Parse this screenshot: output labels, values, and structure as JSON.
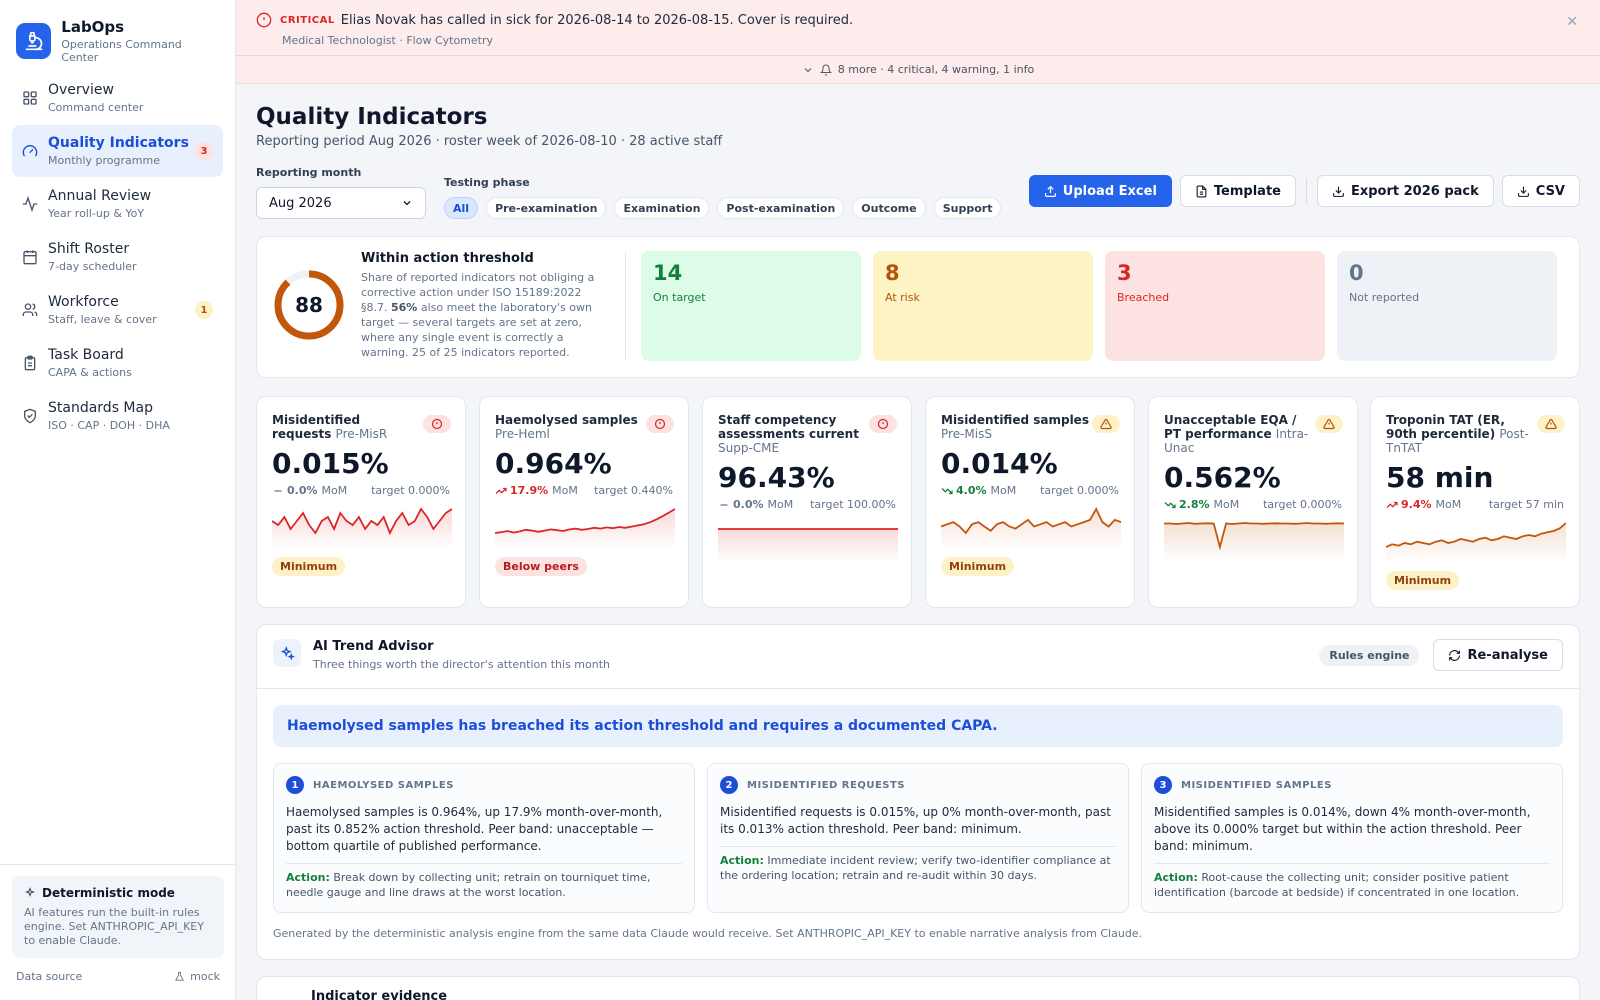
{
  "brand": {
    "name": "LabOps",
    "subtitle": "Operations Command Center"
  },
  "nav": [
    {
      "label": "Overview",
      "sub": "Command center",
      "icon": "grid-icon",
      "badge": ""
    },
    {
      "label": "Quality Indicators",
      "sub": "Monthly programme",
      "icon": "gauge-icon",
      "badge": "3",
      "active": true
    },
    {
      "label": "Annual Review",
      "sub": "Year roll-up & YoY",
      "icon": "activity-icon",
      "badge": ""
    },
    {
      "label": "Shift Roster",
      "sub": "7-day scheduler",
      "icon": "calendar-icon",
      "badge": ""
    },
    {
      "label": "Workforce",
      "sub": "Staff, leave & cover",
      "icon": "users-icon",
      "badge": "1"
    },
    {
      "label": "Task Board",
      "sub": "CAPA & actions",
      "icon": "clipboard-icon",
      "badge": ""
    },
    {
      "label": "Standards Map",
      "sub": "ISO · CAP · DOH · DHA",
      "icon": "shield-icon",
      "badge": ""
    }
  ],
  "deterministic": {
    "title": "Deterministic mode",
    "text": "AI features run the built-in rules engine. Set ANTHROPIC_API_KEY to enable Claude."
  },
  "data_source": {
    "label": "Data source",
    "value": "mock"
  },
  "alert": {
    "level": "CRITICAL",
    "message": "Elias Novak has called in sick for 2026-08-14 to 2026-08-15. Cover is required.",
    "sub": "Medical Technologist · Flow Cytometry",
    "more": "8 more · 4 critical, 4 warning, 1 info"
  },
  "page": {
    "title": "Quality Indicators",
    "subtitle": "Reporting period Aug 2026 · roster week of 2026-08-10 · 28 active staff"
  },
  "controls": {
    "month_label": "Reporting month",
    "month_value": "Aug 2026",
    "phase_label": "Testing phase",
    "phases": [
      "All",
      "Pre-examination",
      "Examination",
      "Post-examination",
      "Outcome",
      "Support"
    ],
    "active_phase": "All",
    "upload": "Upload Excel",
    "template": "Template",
    "export": "Export 2026 pack",
    "csv": "CSV"
  },
  "summary": {
    "score": "88",
    "score_fraction": 0.88,
    "title": "Within action threshold",
    "desc_1": "Share of reported indicators not obliging a corrective action under ISO 15189:2022 §8.7.",
    "desc_pct": "56%",
    "desc_2": "also meet the laboratory's own target — several targets are set at zero, where any single event is correctly a warning. 25 of 25 indicators reported.",
    "stats": [
      {
        "value": "14",
        "label": "On target",
        "tone": "green"
      },
      {
        "value": "8",
        "label": "At risk",
        "tone": "yellow"
      },
      {
        "value": "3",
        "label": "Breached",
        "tone": "red"
      },
      {
        "value": "0",
        "label": "Not reported",
        "tone": "grey"
      }
    ]
  },
  "cards": [
    {
      "title": "Misidentified requests",
      "code": "Pre-MisR",
      "value": "0.015%",
      "delta": "0.0%",
      "trend": "flat",
      "mom": "MoM",
      "target": "target 0.000%",
      "flag": "red",
      "tag": "Minimum",
      "tag_tone": "amber",
      "spark": [
        5,
        4,
        6,
        3,
        5,
        7,
        4,
        2,
        5,
        6,
        3,
        7,
        5,
        4,
        6,
        3,
        5,
        4,
        6,
        2,
        5,
        7,
        4,
        5,
        8,
        6,
        3,
        5,
        7,
        8
      ]
    },
    {
      "title": "Haemolysed samples",
      "code": "Pre-Heml",
      "value": "0.964%",
      "delta": "17.9%",
      "trend": "up",
      "mom": "MoM",
      "target": "target 0.440%",
      "flag": "red",
      "tag": "Below peers",
      "tag_tone": "red",
      "spark": [
        2,
        2.2,
        2.5,
        2.1,
        2.4,
        2.8,
        2.6,
        2.3,
        2.6,
        2.9,
        2.7,
        2.5,
        2.9,
        3.1,
        2.8,
        3,
        3.3,
        3.1,
        3.4,
        3.2,
        3.5,
        3.3,
        3.6,
        3.9,
        4.2,
        4.7,
        5.4,
        6.2,
        7.1,
        8
      ]
    },
    {
      "title": "Staff competency assessments current",
      "code": "Supp-CME",
      "value": "96.43%",
      "delta": "0.0%",
      "trend": "flat",
      "mom": "MoM",
      "target": "target 100.00%",
      "flag": "red",
      "tag": "",
      "tag_tone": "",
      "spark": [
        5,
        5,
        5,
        5,
        5,
        5,
        5,
        5,
        5,
        5,
        5,
        5,
        5,
        5,
        5,
        5,
        5,
        5,
        5,
        5,
        5,
        5,
        5,
        5,
        5,
        5,
        5,
        5,
        5,
        5
      ]
    },
    {
      "title": "Misidentified samples",
      "code": "Pre-MisS",
      "value": "0.014%",
      "delta": "4.0%",
      "trend": "down",
      "mom": "MoM",
      "target": "target 0.000%",
      "flag": "amber",
      "tag": "Minimum",
      "tag_tone": "amber",
      "spark": [
        5,
        5.5,
        6,
        5,
        3.5,
        5.5,
        6,
        5,
        4,
        5.5,
        6,
        5,
        4.5,
        5.5,
        6.5,
        5,
        5.5,
        6,
        5,
        5.5,
        6,
        5,
        5.5,
        6,
        6.5,
        9,
        6,
        5,
        6.5,
        6
      ]
    },
    {
      "title": "Unacceptable EQA / PT performance",
      "code": "Intra-Unac",
      "value": "0.562%",
      "delta": "2.8%",
      "trend": "down",
      "mom": "MoM",
      "target": "target 0.000%",
      "flag": "amber",
      "tag": "",
      "tag_tone": "",
      "spark": [
        6,
        6,
        5.8,
        6,
        6.2,
        5.9,
        6,
        6.1,
        6,
        -3,
        6,
        5.8,
        6,
        6.2,
        6,
        6,
        5.9,
        6,
        6.1,
        6,
        6,
        5.9,
        6,
        6.2,
        6,
        6,
        5.9,
        6,
        6.1,
        6
      ]
    },
    {
      "title": "Troponin TAT (ER, 90th percentile)",
      "code": "Post-TnTAT",
      "value": "58 min",
      "delta": "9.4%",
      "trend": "up",
      "mom": "MoM",
      "target": "target 57 min",
      "flag": "amber",
      "tag": "Minimum",
      "tag_tone": "amber",
      "spark": [
        5,
        5.2,
        5.1,
        5.3,
        5.2,
        5.4,
        5.3,
        5.2,
        5.4,
        5.5,
        5.3,
        5.4,
        5.6,
        5.5,
        5.4,
        5.6,
        5.7,
        5.5,
        5.6,
        5.8,
        5.7,
        5.6,
        5.8,
        5.9,
        5.8,
        6,
        6.1,
        6.2,
        6.4,
        6.8
      ]
    }
  ],
  "advisor": {
    "title": "AI Trend Advisor",
    "subtitle": "Three things worth the director's attention this month",
    "engine": "Rules engine",
    "reanalyse": "Re-analyse",
    "headline": "Haemolysed samples has breached its action threshold and requires a documented CAPA.",
    "insights": [
      {
        "num": "1",
        "title": "HAEMOLYSED SAMPLES",
        "body": "Haemolysed samples is 0.964%, up 17.9% month-over-month, past its 0.852% action threshold. Peer band: unacceptable — bottom quartile of published performance.",
        "action_label": "Action:",
        "action": "Break down by collecting unit; retrain on tourniquet time, needle gauge and line draws at the worst location."
      },
      {
        "num": "2",
        "title": "MISIDENTIFIED REQUESTS",
        "body": "Misidentified requests is 0.015%, up 0% month-over-month, past its 0.013% action threshold. Peer band: minimum.",
        "action_label": "Action:",
        "action": "Immediate incident review; verify two-identifier compliance at the ordering location; retrain and re-audit within 30 days."
      },
      {
        "num": "3",
        "title": "MISIDENTIFIED SAMPLES",
        "body": "Misidentified samples is 0.014%, down 4% month-over-month, above its 0.000% target but within the action threshold. Peer band: minimum.",
        "action_label": "Action:",
        "action": "Root-cause the collecting unit; consider positive patient identification (barcode at bedside) if concentrated in one location."
      }
    ],
    "footer": "Generated by the deterministic analysis engine from the same data Claude would receive. Set ANTHROPIC_API_KEY to enable narrative analysis from Claude."
  },
  "evidence": {
    "title": "Indicator evidence"
  },
  "colors": {
    "accent": "#2563eb",
    "critical": "#dc2626",
    "gauge": "#c2570c",
    "spark_red": "#dc2626",
    "spark_amber": "#c2570c"
  }
}
